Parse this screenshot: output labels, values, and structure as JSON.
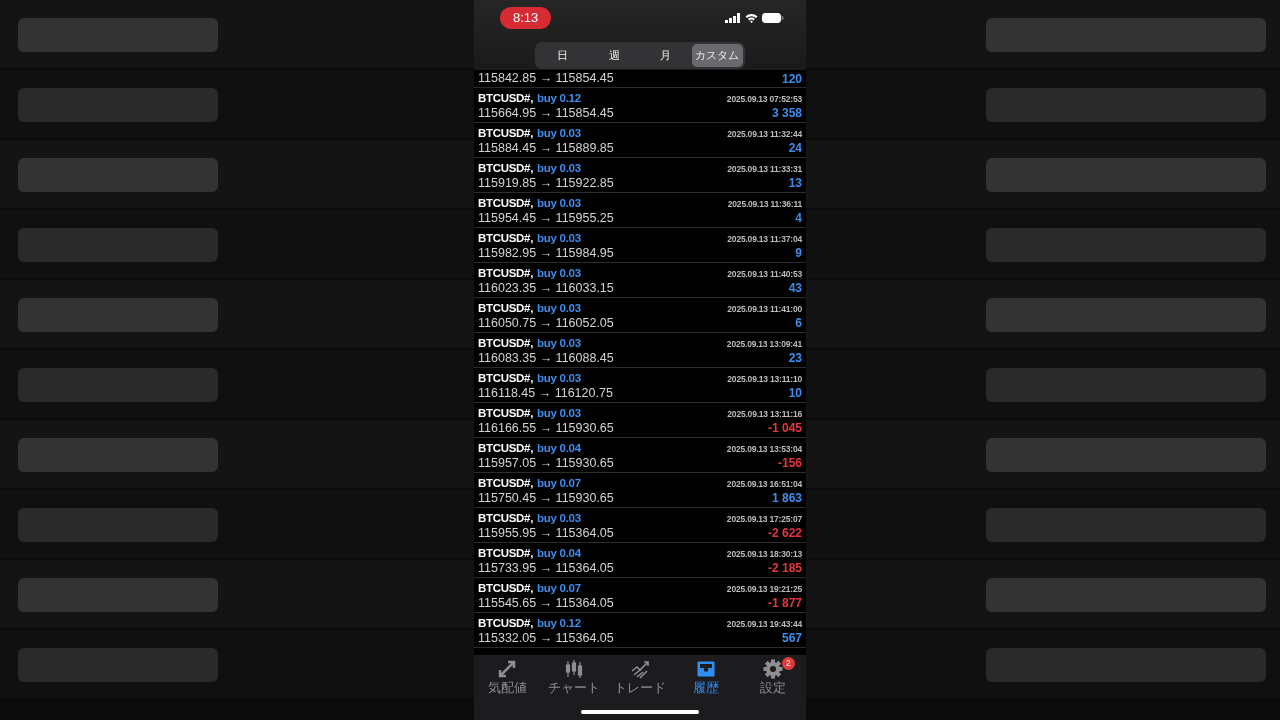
{
  "status_bar": {
    "time": "8:13"
  },
  "segments": [
    {
      "label": "日",
      "selected": false
    },
    {
      "label": "週",
      "selected": false
    },
    {
      "label": "月",
      "selected": false
    },
    {
      "label": "カスタム",
      "selected": true
    }
  ],
  "partial_row": {
    "prices": "115842.85 → 115854.45",
    "profit": "120",
    "negative": false
  },
  "rows": [
    {
      "symbol": "BTCUSD#,",
      "order": "buy 0.12",
      "time": "2025.09.13 07:52:53",
      "prices": "115664.95 → 115854.45",
      "profit": "3 358",
      "negative": false
    },
    {
      "symbol": "BTCUSD#,",
      "order": "buy 0.03",
      "time": "2025.09.13 11:32:44",
      "prices": "115884.45 → 115889.85",
      "profit": "24",
      "negative": false
    },
    {
      "symbol": "BTCUSD#,",
      "order": "buy 0.03",
      "time": "2025.09.13 11:33:31",
      "prices": "115919.85 → 115922.85",
      "profit": "13",
      "negative": false
    },
    {
      "symbol": "BTCUSD#,",
      "order": "buy 0.03",
      "time": "2025.09.13 11:36:11",
      "prices": "115954.45 → 115955.25",
      "profit": "4",
      "negative": false
    },
    {
      "symbol": "BTCUSD#,",
      "order": "buy 0.03",
      "time": "2025.09.13 11:37:04",
      "prices": "115982.95 → 115984.95",
      "profit": "9",
      "negative": false
    },
    {
      "symbol": "BTCUSD#,",
      "order": "buy 0.03",
      "time": "2025.09.13 11:40:53",
      "prices": "116023.35 → 116033.15",
      "profit": "43",
      "negative": false
    },
    {
      "symbol": "BTCUSD#,",
      "order": "buy 0.03",
      "time": "2025.09.13 11:41:00",
      "prices": "116050.75 → 116052.05",
      "profit": "6",
      "negative": false
    },
    {
      "symbol": "BTCUSD#,",
      "order": "buy 0.03",
      "time": "2025.09.13 13:09:41",
      "prices": "116083.35 → 116088.45",
      "profit": "23",
      "negative": false
    },
    {
      "symbol": "BTCUSD#,",
      "order": "buy 0.03",
      "time": "2025.09.13 13:11:10",
      "prices": "116118.45 → 116120.75",
      "profit": "10",
      "negative": false
    },
    {
      "symbol": "BTCUSD#,",
      "order": "buy 0.03",
      "time": "2025.09.13 13:11:16",
      "prices": "116166.55 → 115930.65",
      "profit": "-1 045",
      "negative": true
    },
    {
      "symbol": "BTCUSD#,",
      "order": "buy 0.04",
      "time": "2025.09.13 13:53:04",
      "prices": "115957.05 → 115930.65",
      "profit": "-156",
      "negative": true
    },
    {
      "symbol": "BTCUSD#,",
      "order": "buy 0.07",
      "time": "2025.09.13 16:51:04",
      "prices": "115750.45 → 115930.65",
      "profit": "1 863",
      "negative": false
    },
    {
      "symbol": "BTCUSD#,",
      "order": "buy 0.03",
      "time": "2025.09.13 17:25:07",
      "prices": "115955.95 → 115364.05",
      "profit": "-2 622",
      "negative": true
    },
    {
      "symbol": "BTCUSD#,",
      "order": "buy 0.04",
      "time": "2025.09.13 18:30:13",
      "prices": "115733.95 → 115364.05",
      "profit": "-2 185",
      "negative": true
    },
    {
      "symbol": "BTCUSD#,",
      "order": "buy 0.07",
      "time": "2025.09.13 19:21:25",
      "prices": "115545.65 → 115364.05",
      "profit": "-1 877",
      "negative": true
    },
    {
      "symbol": "BTCUSD#,",
      "order": "buy 0.12",
      "time": "2025.09.13 19:43:44",
      "prices": "115332.05 → 115364.05",
      "profit": "567",
      "negative": false
    }
  ],
  "tab_bar": [
    {
      "kind": "quotes",
      "label": "気配値",
      "selected": false
    },
    {
      "kind": "chart",
      "label": "チャート",
      "selected": false
    },
    {
      "kind": "trade",
      "label": "トレード",
      "selected": false
    },
    {
      "kind": "history",
      "label": "履歴",
      "selected": true
    },
    {
      "kind": "settings",
      "label": "設定",
      "selected": false,
      "badge": "2"
    }
  ]
}
